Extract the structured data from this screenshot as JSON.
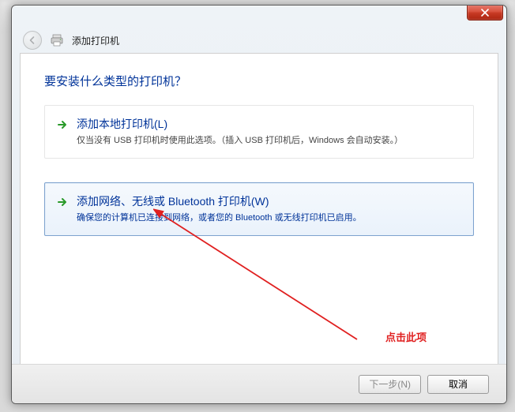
{
  "window": {
    "title": "添加打印机"
  },
  "main": {
    "heading": "要安装什么类型的打印机？"
  },
  "options": {
    "local": {
      "title": "添加本地打印机(L)",
      "desc": "仅当没有 USB 打印机时使用此选项。（插入 USB 打印机后，Windows 会自动安装。）"
    },
    "network": {
      "title": "添加网络、无线或 Bluetooth 打印机(W)",
      "desc": "确保您的计算机已连接到网络，或者您的 Bluetooth 或无线打印机已启用。"
    }
  },
  "annotation": {
    "label": "点击此项"
  },
  "footer": {
    "next": "下一步(N)",
    "cancel": "取消"
  }
}
